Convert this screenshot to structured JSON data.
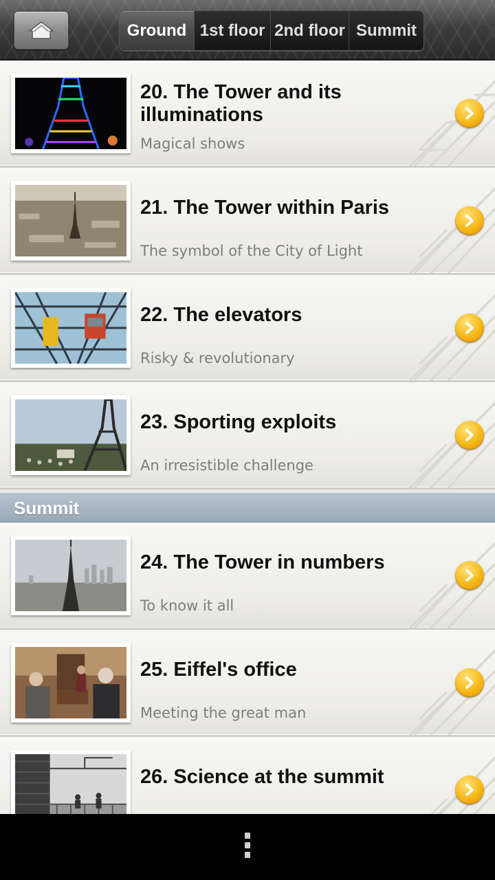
{
  "tabs": [
    {
      "label": "Ground",
      "active": true
    },
    {
      "label": "1st floor",
      "active": false
    },
    {
      "label": "2nd floor",
      "active": false
    },
    {
      "label": "Summit",
      "active": false
    }
  ],
  "items": [
    {
      "title": "20. The Tower and its illuminations",
      "subtitle": "Magical shows",
      "thumb": "illuminated-tower-night"
    },
    {
      "title": "21. The Tower within Paris",
      "subtitle": "The symbol of the City of Light",
      "thumb": "paris-aerial-view"
    },
    {
      "title": "22. The elevators",
      "subtitle": "Risky & revolutionary",
      "thumb": "elevator-cabins"
    },
    {
      "title": "23. Sporting exploits",
      "subtitle": "An irresistible challenge",
      "thumb": "tower-with-crowd"
    },
    {
      "title": "24. The Tower in numbers",
      "subtitle": "To know it all",
      "thumb": "tower-hazy-skyline"
    },
    {
      "title": "25. Eiffel's office",
      "subtitle": "Meeting the great man",
      "thumb": "eiffel-office-figures"
    },
    {
      "title": "26. Science at the summit",
      "subtitle": "",
      "thumb": "summit-platform-bw"
    }
  ],
  "section_header": "Summit",
  "icons": {
    "home": "home-icon",
    "chevron": "chevron-right-icon",
    "menu": "overflow-menu-icon"
  },
  "colors": {
    "chevron": "#f6b818",
    "section_header": "#a7b3bf",
    "topbar": "#3e3e3e"
  }
}
